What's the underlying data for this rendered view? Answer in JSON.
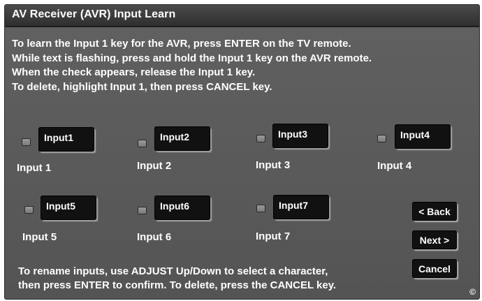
{
  "window": {
    "title": "AV Receiver (AVR) Input Learn"
  },
  "instructions": [
    "To learn the Input 1 key for the AVR, press ENTER on the TV remote.",
    "While text is flashing, press and hold the Input 1 key on the AVR remote.",
    "When the check appears, release the Input 1 key.",
    "To delete, highlight Input 1, then press CANCEL key."
  ],
  "inputs": [
    {
      "field": "Input1",
      "label": "Input 1",
      "checked": false
    },
    {
      "field": "Input2",
      "label": "Input 2",
      "checked": false
    },
    {
      "field": "Input3",
      "label": "Input 3",
      "checked": false
    },
    {
      "field": "Input4",
      "label": "Input 4",
      "checked": false
    },
    {
      "field": "Input5",
      "label": "Input 5",
      "checked": false
    },
    {
      "field": "Input6",
      "label": "Input 6",
      "checked": false
    },
    {
      "field": "Input7",
      "label": "Input 7",
      "checked": false
    }
  ],
  "buttons": {
    "back": "< Back",
    "next": "Next >",
    "cancel": "Cancel"
  },
  "footer": [
    "To rename inputs, use ADJUST Up/Down to select a character,",
    "then press ENTER to confirm. To delete, press the CANCEL key."
  ],
  "copyright_symbol": "©"
}
